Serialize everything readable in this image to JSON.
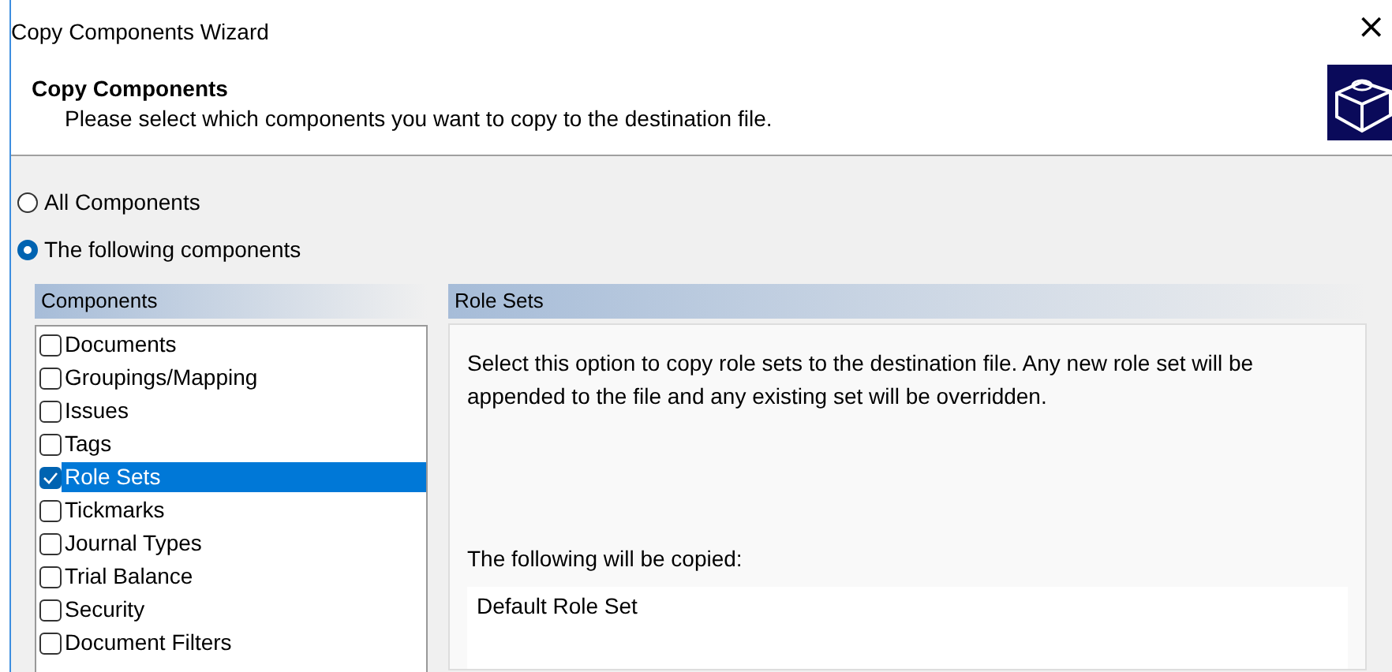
{
  "window": {
    "title": "Copy Components Wizard",
    "close": "×"
  },
  "header": {
    "title": "Copy Components",
    "subtitle": "Please select which components you want to copy to the destination file."
  },
  "options": [
    {
      "label": "All Components",
      "selected": false
    },
    {
      "label": "The following components",
      "selected": true
    }
  ],
  "components": {
    "heading": "Components",
    "items": [
      {
        "label": "Documents",
        "checked": false,
        "selected": false
      },
      {
        "label": "Groupings/Mapping",
        "checked": false,
        "selected": false
      },
      {
        "label": "Issues",
        "checked": false,
        "selected": false
      },
      {
        "label": "Tags",
        "checked": false,
        "selected": false
      },
      {
        "label": "Role Sets",
        "checked": true,
        "selected": true
      },
      {
        "label": "Tickmarks",
        "checked": false,
        "selected": false
      },
      {
        "label": "Journal Types",
        "checked": false,
        "selected": false
      },
      {
        "label": "Trial Balance",
        "checked": false,
        "selected": false
      },
      {
        "label": "Security",
        "checked": false,
        "selected": false
      },
      {
        "label": "Document Filters",
        "checked": false,
        "selected": false
      }
    ]
  },
  "details": {
    "heading": "Role Sets",
    "description": "Select this option to copy role sets to the destination file.  Any new role set will be appended to the file and any existing set will be overridden.",
    "copied_label": "The following will be copied:",
    "copied_items": [
      "Default Role Set"
    ]
  }
}
